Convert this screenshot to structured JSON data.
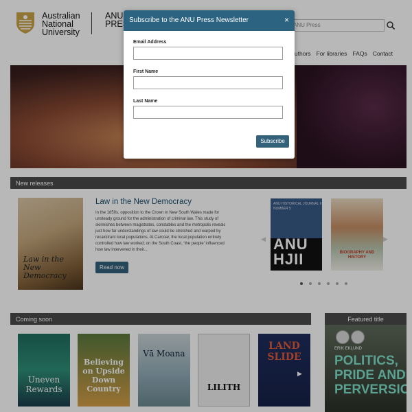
{
  "header": {
    "university": [
      "Australian",
      "National",
      "University"
    ],
    "press_label": [
      "ANU",
      "PRESS"
    ],
    "search_placeholder": "ANU Press"
  },
  "nav": [
    "For authors",
    "For libraries",
    "FAQs",
    "Contact"
  ],
  "sections": {
    "new_releases": "New releases",
    "coming_soon": "Coming soon",
    "featured_title": "Featured title"
  },
  "new_release": {
    "title": "Law in the New Democracy",
    "description": "In the 1850s, opposition to the Crown in New South Wales made for unsteady ground for the administration of criminal law. This study of skirmishes between magistrates, constables and the metropolis reveals just how far understandings of law could be stretched and warped by recalcitrant local populations. At Carcoar, the local population entirely controlled how law worked; on the South Coast, ‘the people’ influenced how law intervened in their...",
    "button": "Read now",
    "cover_text": "Law in the New Democracy"
  },
  "carousel": {
    "cover1_small": "ANU HISTORICAL JOURNAL II NUMBER 5",
    "cover1_big": "ANU HJII",
    "cover2_text": "BIOGRAPHY AND HISTORY",
    "dots": 6
  },
  "coming_soon": [
    {
      "cover_text": "Uneven Rewards"
    },
    {
      "cover_text": "Believing on Upside Down Country"
    },
    {
      "cover_text": "Vā Moana"
    },
    {
      "cover_text": "LILITH"
    },
    {
      "cover_text": "LAND SLIDE"
    }
  ],
  "featured": {
    "author": "ERIK EKLUND",
    "title": "POLITICS, PRIDE AND PERVERSION"
  },
  "modal": {
    "title": "Subscribe to the ANU Press Newsletter",
    "close": "×",
    "email_label": "Email Address",
    "first_label": "First Name",
    "last_label": "Last Name",
    "submit": "Subscribe"
  }
}
